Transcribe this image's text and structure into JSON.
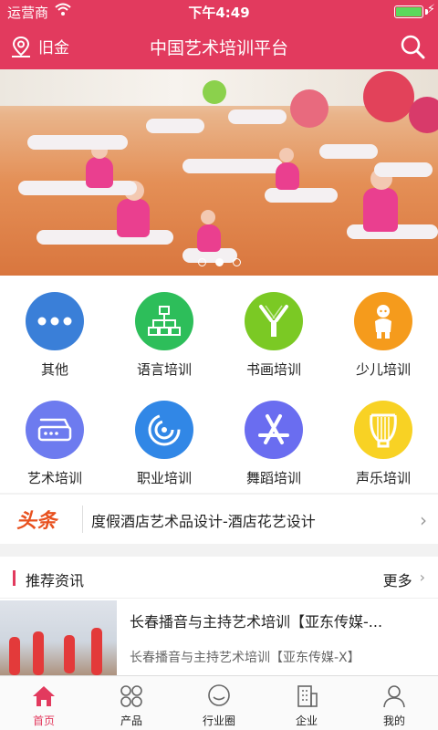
{
  "status": {
    "carrier": "运营商",
    "time": "下午4:49"
  },
  "nav": {
    "location": "旧金",
    "title": "中国艺术培训平台"
  },
  "banner": {
    "slides": 3,
    "active_slide": 1
  },
  "categories": [
    {
      "label": "其他",
      "icon": "more-dots-icon",
      "color": "#3a7fd8"
    },
    {
      "label": "语言培训",
      "icon": "sitemap-icon",
      "color": "#2dbe5a"
    },
    {
      "label": "书画培训",
      "icon": "brush-fork-icon",
      "color": "#7bc924"
    },
    {
      "label": "少儿培训",
      "icon": "child-icon",
      "color": "#f59b1c"
    },
    {
      "label": "艺术培训",
      "icon": "router-icon",
      "color": "#6d7bef"
    },
    {
      "label": "职业培训",
      "icon": "signal-icon",
      "color": "#3187e6"
    },
    {
      "label": "舞蹈培训",
      "icon": "app-store-icon",
      "color": "#6a6df0"
    },
    {
      "label": "声乐培训",
      "icon": "lyre-icon",
      "color": "#f8d224"
    }
  ],
  "headline": {
    "tag": "头条",
    "text": "度假酒店艺术品设计-酒店花艺设计"
  },
  "recommend": {
    "title": "推荐资讯",
    "more": "更多",
    "items": [
      {
        "title": "长春播音与主持艺术培训【亚东传媒-...",
        "subtitle": "长春播音与主持艺术培训【亚东传媒-X】"
      }
    ]
  },
  "tabs": [
    {
      "label": "首页",
      "icon": "home-icon",
      "active": true
    },
    {
      "label": "产品",
      "icon": "product-grid-icon",
      "active": false
    },
    {
      "label": "行业圈",
      "icon": "chat-bubble-icon",
      "active": false
    },
    {
      "label": "企业",
      "icon": "building-icon",
      "active": false
    },
    {
      "label": "我的",
      "icon": "user-icon",
      "active": false
    }
  ],
  "colors": {
    "brand": "#e23a5e",
    "headline_tag": "#e8511f"
  }
}
